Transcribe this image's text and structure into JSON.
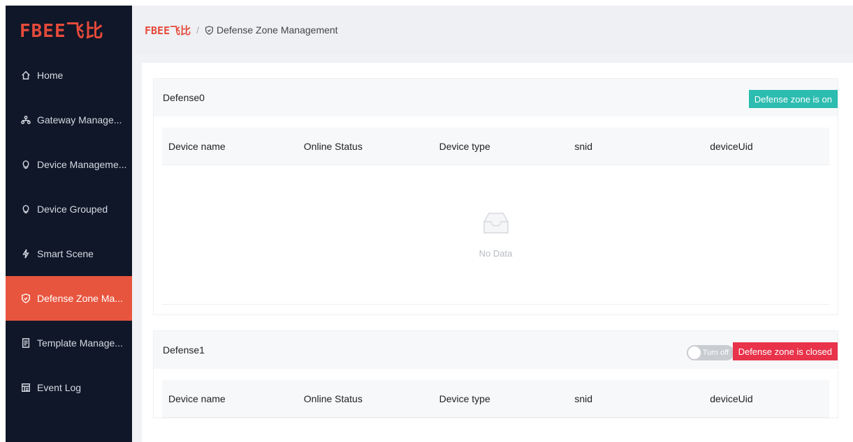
{
  "sidebar": {
    "logo": "FBEE飞比",
    "items": [
      {
        "label": "Home",
        "icon": "home-icon",
        "active": false
      },
      {
        "label": "Gateway Manage...",
        "icon": "network-icon",
        "active": false
      },
      {
        "label": "Device Manageme...",
        "icon": "bulb-icon",
        "active": false
      },
      {
        "label": "Device Grouped",
        "icon": "bulb-icon",
        "active": false
      },
      {
        "label": "Smart Scene",
        "icon": "lightning-icon",
        "active": false
      },
      {
        "label": "Defense Zone Ma...",
        "icon": "shield-icon",
        "active": true
      },
      {
        "label": "Template Manage...",
        "icon": "document-icon",
        "active": false
      },
      {
        "label": "Event Log",
        "icon": "log-icon",
        "active": false
      }
    ]
  },
  "header": {
    "brand": "FBEE飞比",
    "separator": "/",
    "page_title": "Defense Zone Management"
  },
  "table_columns": [
    "Device name",
    "Online Status",
    "Device type",
    "snid",
    "deviceUid"
  ],
  "zones": [
    {
      "name": "Defense0",
      "status_badge": "Defense zone is on",
      "empty_text": "No Data"
    },
    {
      "name": "Defense1",
      "toggle_label": "Turn off",
      "status_badge": "Defense zone is closed"
    }
  ],
  "colors": {
    "sidebar_bg": "#0f1728",
    "active_item": "#e8553e",
    "brand": "#e64a3b",
    "badge_on": "#2cbcb0",
    "badge_off": "#e8334a"
  }
}
